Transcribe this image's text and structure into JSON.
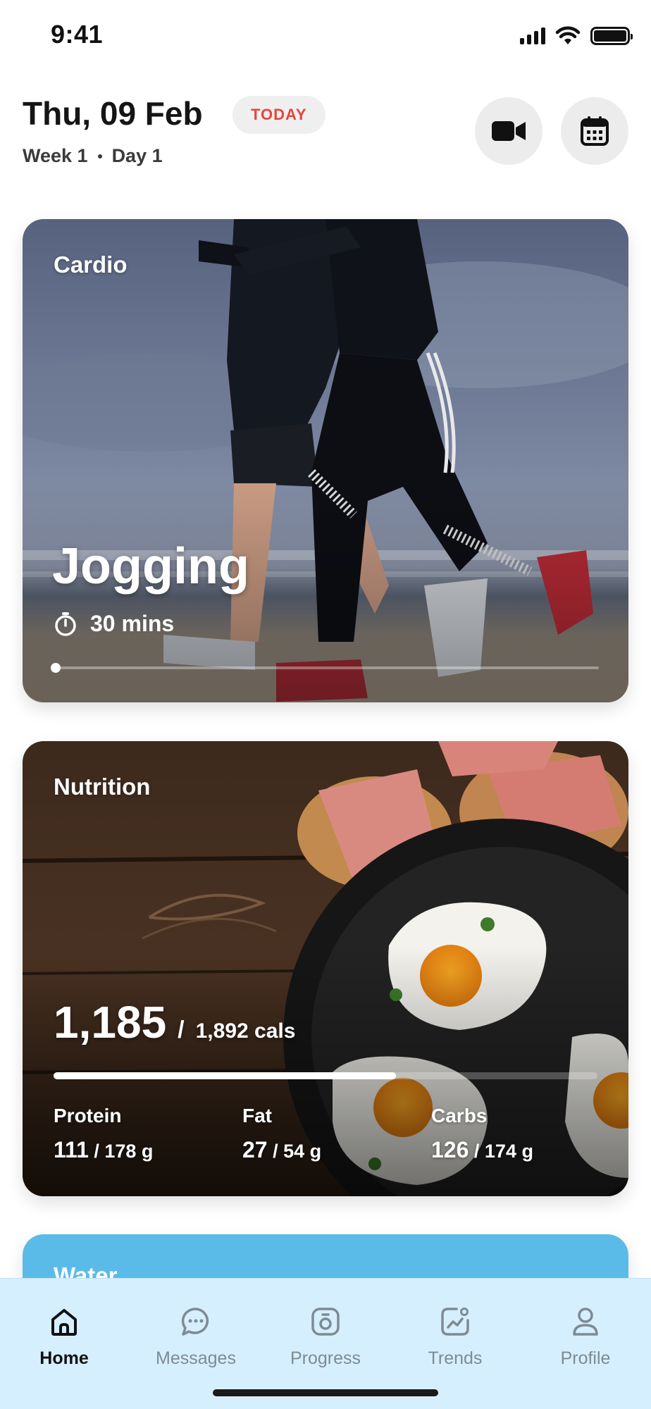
{
  "status_bar": {
    "time": "9:41"
  },
  "header": {
    "date": "Thu, 09 Feb",
    "today_badge": "TODAY",
    "week_label": "Week 1",
    "day_label": "Day 1"
  },
  "cardio": {
    "category": "Cardio",
    "title": "Jogging",
    "duration": "30 mins",
    "progress": 0
  },
  "nutrition": {
    "category": "Nutrition",
    "calories": "1,185",
    "separator": "/",
    "calorie_goal": "1,892 cals",
    "progress": 0.63,
    "macros": [
      {
        "name": "Protein",
        "value": "111",
        "goal": "/ 178 g"
      },
      {
        "name": "Fat",
        "value": "27",
        "goal": "/ 54 g"
      },
      {
        "name": "Carbs",
        "value": "126",
        "goal": "/ 174 g"
      }
    ]
  },
  "water": {
    "category": "Water"
  },
  "nav": {
    "items": [
      {
        "label": "Home",
        "icon": "home-icon",
        "active": true
      },
      {
        "label": "Messages",
        "icon": "messages-icon",
        "active": false
      },
      {
        "label": "Progress",
        "icon": "progress-icon",
        "active": false
      },
      {
        "label": "Trends",
        "icon": "trends-icon",
        "active": false
      },
      {
        "label": "Profile",
        "icon": "profile-icon",
        "active": false
      }
    ]
  },
  "colors": {
    "accent_red": "#e8443a",
    "nav_background": "#d6efff",
    "water_blue": "#5bbbe8"
  }
}
